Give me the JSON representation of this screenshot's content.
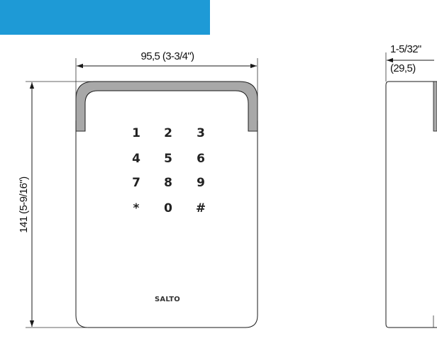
{
  "header": {
    "color": "#1e9ad6"
  },
  "dimensions": {
    "front_width": "95,5 (3-3/4\")",
    "front_height": "141 (5-9/16\")",
    "side_depth_imperial": "1-5/32\"",
    "side_depth_metric": "(29,5)"
  },
  "keypad": {
    "keys": [
      "1",
      "2",
      "3",
      "4",
      "5",
      "6",
      "7",
      "8",
      "9",
      "*",
      "0",
      "#"
    ]
  },
  "brand": {
    "logo": "SALTO"
  }
}
